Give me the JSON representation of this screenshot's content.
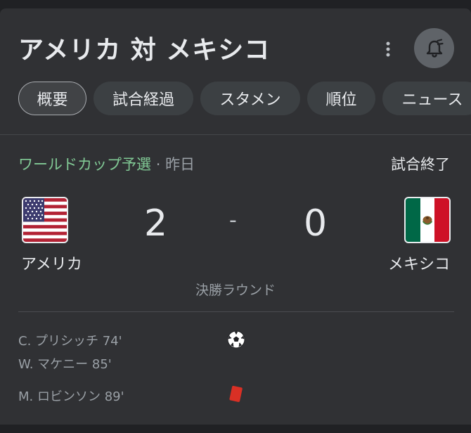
{
  "match": {
    "title": "アメリカ 対 メキシコ",
    "tabs": [
      "概要",
      "試合経過",
      "スタメン",
      "順位",
      "ニュース"
    ],
    "competition": "ワールドカップ予選",
    "separator": "·",
    "date": "昨日",
    "status": "試合終了",
    "round": "決勝ラウンド",
    "home": {
      "name": "アメリカ",
      "score": "2",
      "flag": "usa-flag"
    },
    "away": {
      "name": "メキシコ",
      "score": "0",
      "flag": "mexico-flag"
    },
    "score_separator": "-",
    "events": [
      {
        "text": "C. プリシッチ 74'",
        "type": "goal"
      },
      {
        "text": "W. マケニー 85'",
        "type": "goal"
      },
      {
        "text": "M. ロビンソン 89'",
        "type": "red-card"
      }
    ]
  },
  "icons": {
    "more": "more-vert-icon",
    "bell": "bell-alarm-icon",
    "goal": "soccer-ball-icon",
    "card": "red-card-icon"
  },
  "colors": {
    "background": "#202124",
    "card": "#303134",
    "competition": "#81c995",
    "red_card": "#d93025"
  }
}
